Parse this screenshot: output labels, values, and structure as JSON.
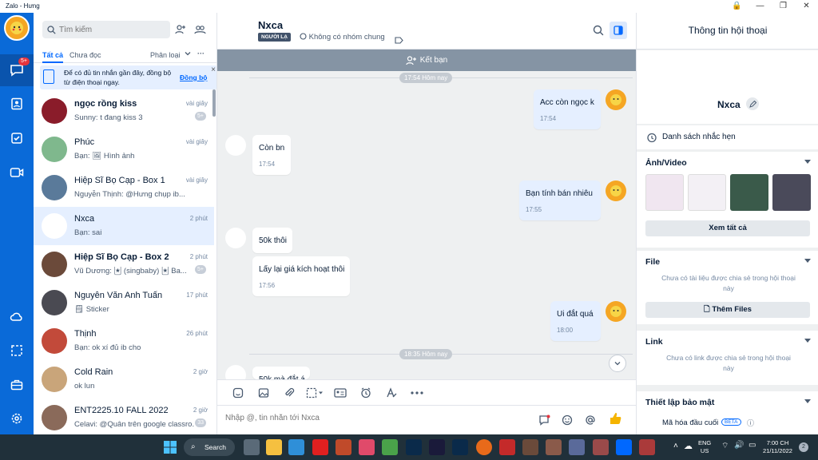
{
  "window": {
    "title": "Zalo - Hưng"
  },
  "search": {
    "placeholder": "Tìm kiếm"
  },
  "nav": {
    "badge": "5+"
  },
  "filters": {
    "all": "Tất cả",
    "unread": "Chưa đọc",
    "sort": "Phân loại",
    "more": "···"
  },
  "notice": {
    "text": "Để có đủ tin nhắn gần đây, đồng bộ từ điện thoại ngay.",
    "sync": "Đồng bộ",
    "close": "×"
  },
  "conversations": [
    {
      "name": "ngọc rồng kiss",
      "preview": "Sunny: t đang kiss 3",
      "time": "vài giây",
      "count": "5+",
      "bold": true,
      "avatar": "#8a1c2a"
    },
    {
      "name": "Phúc",
      "preview": "Bạn: 🖼 Hình ảnh",
      "time": "vài giây",
      "count": "",
      "bold": false,
      "avatar": "#7fb88d"
    },
    {
      "name": "Hiệp Sĩ Bọ Cạp - Box 1",
      "preview": "Nguyễn Thịnh: @Hưng chụp ib...",
      "time": "vài giây",
      "count": "",
      "bold": false,
      "avatar": "#5a7a9a"
    },
    {
      "name": "Nxca",
      "preview": "Bạn: sai",
      "time": "2 phút",
      "count": "",
      "bold": false,
      "avatar": "#ffffff"
    },
    {
      "name": "Hiệp Sĩ Bọ Cạp - Box 2",
      "preview": "Vũ Dương: 🃏 (singbaby) 🃏 Ba...",
      "time": "2 phút",
      "count": "5+",
      "bold": true,
      "avatar": "#6b4a3a"
    },
    {
      "name": "Nguyễn Văn Anh Tuấn",
      "preview": "🗒 Sticker",
      "time": "17 phút",
      "count": "",
      "bold": false,
      "avatar": "#4a4a52"
    },
    {
      "name": "Thịnh",
      "preview": "Bạn: ok xí đủ ib cho",
      "time": "26 phút",
      "count": "",
      "bold": false,
      "avatar": "#c24a3a"
    },
    {
      "name": "Cold Rain",
      "preview": "ok lun",
      "time": "2 giờ",
      "count": "",
      "bold": false,
      "avatar": "#c9a57a"
    },
    {
      "name": "ENT2225.10 FALL 2022",
      "preview": "Celavi: @Quân trên google classro...",
      "time": "2 giờ",
      "count": "33",
      "bold": false,
      "avatar": "#8a6a5a"
    }
  ],
  "chat": {
    "title": "Nxca",
    "tag": "NGƯỜI LẠ",
    "group_info": "Không có nhóm chung",
    "add_friend": "Kết bạn",
    "time_sep_1": "17:54 Hôm nay",
    "time_sep_2": "18:35 Hôm nay",
    "messages": [
      {
        "text": "Acc còn ngọc k",
        "time": "17:54",
        "mine": true
      },
      {
        "text": "Còn bn",
        "time": "17:54",
        "mine": false
      },
      {
        "text": "Bạn tính bán nhiêu",
        "time": "17:55",
        "mine": true
      },
      {
        "text": "50k thôi",
        "time": "",
        "mine": false
      },
      {
        "text": "Lấy lại giá kích hoạt thôi",
        "time": "17:56",
        "mine": false
      },
      {
        "text": "Ui đắt quá",
        "time": "18:00",
        "mine": true
      },
      {
        "text": "50k mà đắt á",
        "time": "",
        "mine": false
      }
    ],
    "compose_placeholder": "Nhập @, tin nhắn tới Nxca"
  },
  "info": {
    "header": "Thông tin hội thoại",
    "name": "Nxca",
    "reminders": "Danh sách nhắc hẹn",
    "media_title": "Ảnh/Video",
    "view_all": "Xem tất cả",
    "file_title": "File",
    "file_empty": "Chưa có tài liệu được chia sẻ trong hội thoại này",
    "add_files": "Thêm Files",
    "link_title": "Link",
    "link_empty": "Chưa có link được chia sẻ trong hội thoại này",
    "security_title": "Thiết lập bảo mật",
    "e2e": "Mã hóa đầu cuối",
    "beta": "BETA"
  },
  "taskbar": {
    "search": "Search",
    "lang1": "ENG",
    "lang2": "US",
    "time": "7:00 CH",
    "date": "21/11/2022",
    "notif": "2"
  }
}
